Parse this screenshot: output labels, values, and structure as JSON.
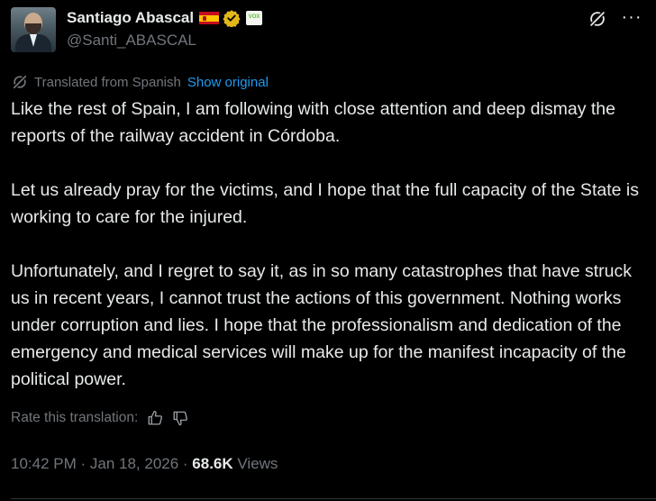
{
  "author": {
    "name": "Santiago Abascal",
    "handle": "@Santi_ABASCAL",
    "badges": [
      "spain-flag-icon",
      "verified-badge-icon",
      "vox-party-icon"
    ],
    "party_badge_text": "VOX",
    "verified_color": "#e2b719"
  },
  "translation": {
    "label": "Translated from Spanish",
    "show_original": "Show original",
    "rate_label": "Rate this translation:"
  },
  "post": {
    "paragraphs": [
      "Like the rest of Spain, I am following with close attention and deep dismay the reports of the railway accident in Córdoba.",
      "Let us already pray for the victims, and I hope that the full capacity of the State is working to care for the injured.",
      "Unfortunately, and I regret to say it, as in so many catastrophes that have struck us in recent years, I cannot trust the actions of this government. Nothing works under corruption and lies. I hope that the professionalism and dedication of the emergency and medical services will make up for the manifest incapacity of the political power."
    ]
  },
  "meta": {
    "time": "10:42 PM",
    "sep1": " · ",
    "date": "Jan 18, 2026",
    "sep2": " · ",
    "views_count": "68.6K",
    "views_label": " Views"
  },
  "colors": {
    "background": "#000000",
    "text": "#e7e9ea",
    "secondary": "#71767b",
    "link": "#1d9bf0"
  }
}
